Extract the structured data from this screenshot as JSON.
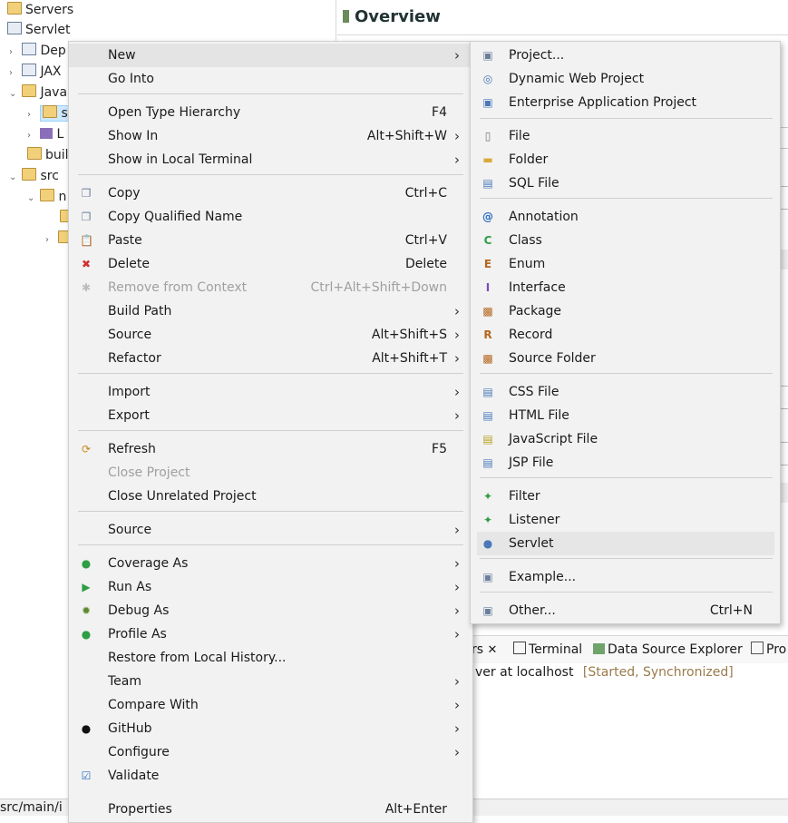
{
  "explorer": {
    "rows": [
      {
        "text": "Servers"
      },
      {
        "text": "Servlet"
      },
      {
        "text": "Dep"
      },
      {
        "text": "JAX"
      },
      {
        "text": "Java"
      },
      {
        "text": "s"
      },
      {
        "text": "L"
      },
      {
        "text": "buil"
      },
      {
        "text": "src"
      },
      {
        "text": "n"
      },
      {
        "text": ""
      },
      {
        "text": ""
      }
    ],
    "status_path": "src/main/i"
  },
  "overview": {
    "title": "Overview"
  },
  "bottom_panel": {
    "tabs": [
      {
        "label": "rs"
      },
      {
        "label": "Terminal"
      },
      {
        "label": "Data Source Explorer"
      },
      {
        "label": "Pro"
      }
    ],
    "server_row": "ver at localhost",
    "server_status": "[Started, Synchronized]"
  },
  "context_menu": {
    "items": [
      {
        "label": "New",
        "shortcut": "",
        "submenu": true,
        "icon": "",
        "disabled": false
      },
      {
        "label": "Go Into",
        "shortcut": "",
        "submenu": false,
        "icon": "",
        "disabled": false
      },
      {
        "label": "Open Type Hierarchy",
        "shortcut": "F4",
        "submenu": false,
        "icon": "",
        "disabled": false
      },
      {
        "label": "Show In",
        "shortcut": "Alt+Shift+W",
        "submenu": true,
        "icon": "",
        "disabled": false
      },
      {
        "label": "Show in Local Terminal",
        "shortcut": "",
        "submenu": true,
        "icon": "",
        "disabled": false
      },
      {
        "label": "Copy",
        "shortcut": "Ctrl+C",
        "submenu": false,
        "icon": "copy-icon",
        "disabled": false
      },
      {
        "label": "Copy Qualified Name",
        "shortcut": "",
        "submenu": false,
        "icon": "copy-qualified-icon",
        "disabled": false
      },
      {
        "label": "Paste",
        "shortcut": "Ctrl+V",
        "submenu": false,
        "icon": "paste-icon",
        "disabled": false
      },
      {
        "label": "Delete",
        "shortcut": "Delete",
        "submenu": false,
        "icon": "delete-icon",
        "disabled": false
      },
      {
        "label": "Remove from Context",
        "shortcut": "Ctrl+Alt+Shift+Down",
        "submenu": false,
        "icon": "remove-context-icon",
        "disabled": true
      },
      {
        "label": "Build Path",
        "shortcut": "",
        "submenu": true,
        "icon": "",
        "disabled": false
      },
      {
        "label": "Source",
        "shortcut": "Alt+Shift+S",
        "submenu": true,
        "icon": "",
        "disabled": false
      },
      {
        "label": "Refactor",
        "shortcut": "Alt+Shift+T",
        "submenu": true,
        "icon": "",
        "disabled": false
      },
      {
        "label": "Import",
        "shortcut": "",
        "submenu": true,
        "icon": "",
        "disabled": false
      },
      {
        "label": "Export",
        "shortcut": "",
        "submenu": true,
        "icon": "",
        "disabled": false
      },
      {
        "label": "Refresh",
        "shortcut": "F5",
        "submenu": false,
        "icon": "refresh-icon",
        "disabled": false
      },
      {
        "label": "Close Project",
        "shortcut": "",
        "submenu": false,
        "icon": "",
        "disabled": true
      },
      {
        "label": "Close Unrelated Project",
        "shortcut": "",
        "submenu": false,
        "icon": "",
        "disabled": false
      },
      {
        "label": "Source",
        "shortcut": "",
        "submenu": true,
        "icon": "",
        "disabled": false
      },
      {
        "label": "Coverage As",
        "shortcut": "",
        "submenu": true,
        "icon": "coverage-icon",
        "disabled": false
      },
      {
        "label": "Run As",
        "shortcut": "",
        "submenu": true,
        "icon": "run-icon",
        "disabled": false
      },
      {
        "label": "Debug As",
        "shortcut": "",
        "submenu": true,
        "icon": "debug-icon",
        "disabled": false
      },
      {
        "label": "Profile As",
        "shortcut": "",
        "submenu": true,
        "icon": "profile-icon",
        "disabled": false
      },
      {
        "label": "Restore from Local History...",
        "shortcut": "",
        "submenu": false,
        "icon": "",
        "disabled": false
      },
      {
        "label": "Team",
        "shortcut": "",
        "submenu": true,
        "icon": "",
        "disabled": false
      },
      {
        "label": "Compare With",
        "shortcut": "",
        "submenu": true,
        "icon": "",
        "disabled": false
      },
      {
        "label": "GitHub",
        "shortcut": "",
        "submenu": true,
        "icon": "github-icon",
        "disabled": false
      },
      {
        "label": "Configure",
        "shortcut": "",
        "submenu": true,
        "icon": "",
        "disabled": false
      },
      {
        "label": "Validate",
        "shortcut": "",
        "submenu": false,
        "icon": "validate-check-icon",
        "disabled": false
      },
      {
        "label": "Properties",
        "shortcut": "Alt+Enter",
        "submenu": false,
        "icon": "",
        "disabled": false
      }
    ]
  },
  "new_submenu": {
    "items": [
      {
        "label": "Project...",
        "shortcut": "",
        "icon": "new-project-icon"
      },
      {
        "label": "Dynamic Web Project",
        "shortcut": "",
        "icon": "dynamic-web-project-icon"
      },
      {
        "label": "Enterprise Application Project",
        "shortcut": "",
        "icon": "enterprise-app-project-icon"
      },
      {
        "label": "File",
        "shortcut": "",
        "icon": "file-icon"
      },
      {
        "label": "Folder",
        "shortcut": "",
        "icon": "folder-icon"
      },
      {
        "label": "SQL File",
        "shortcut": "",
        "icon": "sql-file-icon"
      },
      {
        "label": "Annotation",
        "shortcut": "",
        "icon": "annotation-icon"
      },
      {
        "label": "Class",
        "shortcut": "",
        "icon": "class-icon"
      },
      {
        "label": "Enum",
        "shortcut": "",
        "icon": "enum-icon"
      },
      {
        "label": "Interface",
        "shortcut": "",
        "icon": "interface-icon"
      },
      {
        "label": "Package",
        "shortcut": "",
        "icon": "package-icon"
      },
      {
        "label": "Record",
        "shortcut": "",
        "icon": "record-icon"
      },
      {
        "label": "Source Folder",
        "shortcut": "",
        "icon": "source-folder-icon"
      },
      {
        "label": "CSS File",
        "shortcut": "",
        "icon": "css-file-icon"
      },
      {
        "label": "HTML File",
        "shortcut": "",
        "icon": "html-file-icon"
      },
      {
        "label": "JavaScript File",
        "shortcut": "",
        "icon": "javascript-file-icon"
      },
      {
        "label": "JSP File",
        "shortcut": "",
        "icon": "jsp-file-icon"
      },
      {
        "label": "Filter",
        "shortcut": "",
        "icon": "filter-icon"
      },
      {
        "label": "Listener",
        "shortcut": "",
        "icon": "listener-icon"
      },
      {
        "label": "Servlet",
        "shortcut": "",
        "icon": "servlet-icon"
      },
      {
        "label": "Example...",
        "shortcut": "",
        "icon": "example-icon"
      },
      {
        "label": "Other...",
        "shortcut": "Ctrl+N",
        "icon": "other-wizard-icon"
      }
    ]
  },
  "colors": {
    "accent": "#0078d7",
    "menu_bg": "#f2f2f2",
    "disabled": "#a0a0a0",
    "highlight": "#e4e4e4"
  }
}
